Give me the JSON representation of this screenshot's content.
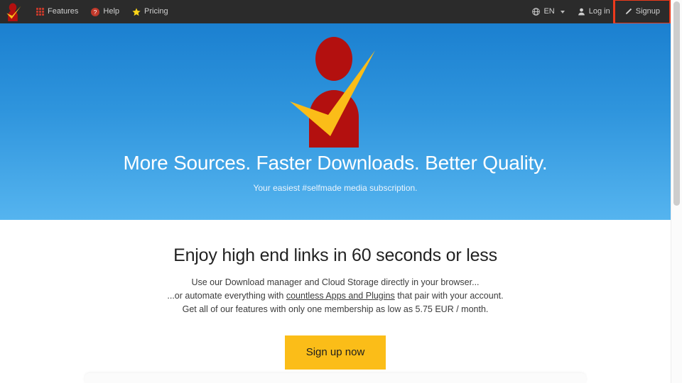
{
  "navbar": {
    "logo_icon": "checkmark-person-logo",
    "items": [
      {
        "label": "Features",
        "icon": "grid-icon"
      },
      {
        "label": "Help",
        "icon": "question-circle-icon"
      },
      {
        "label": "Pricing",
        "icon": "star-icon"
      }
    ],
    "language": {
      "label": "EN",
      "icon": "globe-icon",
      "caret": "chevron-down-icon"
    },
    "login": {
      "label": "Log in",
      "icon": "person-icon"
    },
    "signup": {
      "label": "Signup",
      "icon": "pencil-icon",
      "highlight_color": "#ec3a1c"
    }
  },
  "hero": {
    "graphic_icon": "checkmark-person-mascot",
    "title": "More Sources. Faster Downloads. Better Quality.",
    "subtitle": "Your easiest #selfmade media subscription.",
    "gradient_top": "#1b80d0",
    "gradient_bottom": "#55b4ef"
  },
  "main": {
    "heading": "Enjoy high end links in 60 seconds or less",
    "line1": "Use our Download manager and Cloud Storage directly in your browser...",
    "line2_before": "...or automate everything with ",
    "line2_link": "countless Apps and Plugins",
    "line2_after": " that pair with your account.",
    "line3": "Get all of our features with only one membership as low as 5.75 EUR / month.",
    "cta_label": "Sign up now",
    "cta_color": "#fbbd18"
  },
  "scrollbar": {
    "thumb_label": "vertical-scroll-thumb"
  }
}
